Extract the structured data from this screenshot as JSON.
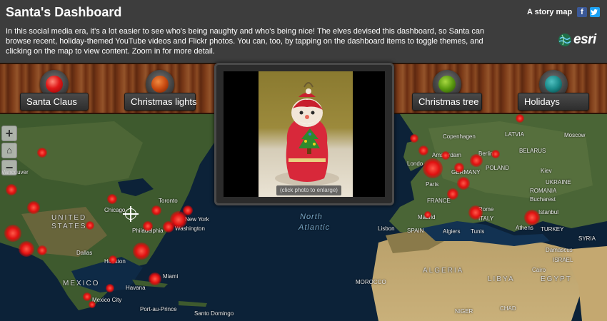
{
  "header": {
    "title": "Santa's Dashboard",
    "description": "In this social media era, it's a lot easier to see who's being naughty and who's being nice! The elves devised this dashboard, so Santa can browse recent, holiday-themed YouTube videos and Flickr photos. You can, too, by tapping on the dashboard items to toggle themes, and clicking on the map to view content. Zoom in for more detail.",
    "story_map_label": "A story map",
    "facebook_glyph": "f",
    "twitter_glyph": "t",
    "brand": "esri"
  },
  "themes": [
    {
      "label": "Santa Claus",
      "color": "#e01818",
      "icon": "red-bulb"
    },
    {
      "label": "Christmas lights",
      "color": "#c84a10",
      "icon": "orange-bulb"
    },
    {
      "label": "Christmas tree",
      "color": "#5a9a10",
      "icon": "green-bulb"
    },
    {
      "label": "Holidays",
      "color": "#1a8a8a",
      "icon": "teal-bulb"
    }
  ],
  "popup": {
    "caption": "(click photo to enlarge)"
  },
  "map": {
    "zoom_in": "+",
    "zoom_out": "−",
    "home": "⌂",
    "labels": {
      "united_states": "UNITED\nSTATES",
      "mexico": "MEXICO",
      "algeria": "ALGERIA",
      "libya": "LIBYA",
      "egypt": "EGYPT",
      "morocco": "MOROCCO",
      "niger": "NIGER",
      "chad": "CHAD",
      "north_atlantic": "North",
      "atlantic": "Atlantic",
      "chicago": "Chicago",
      "toronto": "Toronto",
      "new_york": "New York",
      "washington": "Washington",
      "philadelphia": "Philadelphia",
      "dallas": "Dallas",
      "houston": "Houston",
      "miami": "Miami",
      "havana": "Havana",
      "mexico_city": "Mexico City",
      "port_au_prince": "Port-au-Prince",
      "santo_domingo": "Santo Domingo",
      "vancouver": "Vancouver",
      "copenhagen": "Copenhagen",
      "latvia": "LATVIA",
      "moscow": "Moscow",
      "belarus": "BELARUS",
      "amsterdam": "Amsterdam",
      "berlin": "Berlin",
      "london": "Londo",
      "poland": "POLAND",
      "germany": "GERMANY",
      "kiev": "Kiev",
      "ukraine": "UKRAINE",
      "paris": "Paris",
      "france": "FRANCE",
      "bucharest": "Bucharest",
      "rome": "Rome",
      "istanbul": "Istanbul",
      "italy": "ITALY",
      "spain": "SPAIN",
      "lisbon": "Lisbon",
      "madrid": "Madrid",
      "algiers": "Algiers",
      "tunis": "Tunis",
      "athens": "Athens",
      "turkey": "TURKEY",
      "damascus": "Damascus",
      "cairo": "Cairo",
      "israel": "ISRAEL",
      "syria": "SYRIA",
      "romania": "ROMANIA"
    }
  }
}
